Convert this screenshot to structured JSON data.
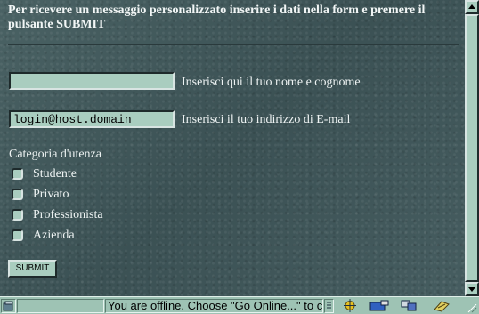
{
  "form": {
    "heading": "Per ricevere un messaggio personalizzato inserire i dati nella form e premere il pulsante SUBMIT",
    "name_field": {
      "value": "",
      "label": "Inserisci qui il tuo nome e cognome"
    },
    "email_field": {
      "value": "login@host.domain",
      "label": "Inserisci il tuo indirizzo di E-mail"
    },
    "category_label": "Categoria d'utenza",
    "categories": [
      "Studente",
      "Privato",
      "Professionista",
      "Azienda"
    ],
    "submit_label": "SUBMIT"
  },
  "statusbar": {
    "message": "You are offline. Choose \"Go Online...\" to c"
  },
  "icons": {
    "left": "document-icon",
    "pane2": "lock-icon",
    "tray": [
      "offline-icon",
      "navigator-icon",
      "mail-icon",
      "chat-icon",
      "composer-icon"
    ]
  },
  "colors": {
    "background": "#415759",
    "field": "#a9cdbf",
    "text": "#eef3f3"
  }
}
